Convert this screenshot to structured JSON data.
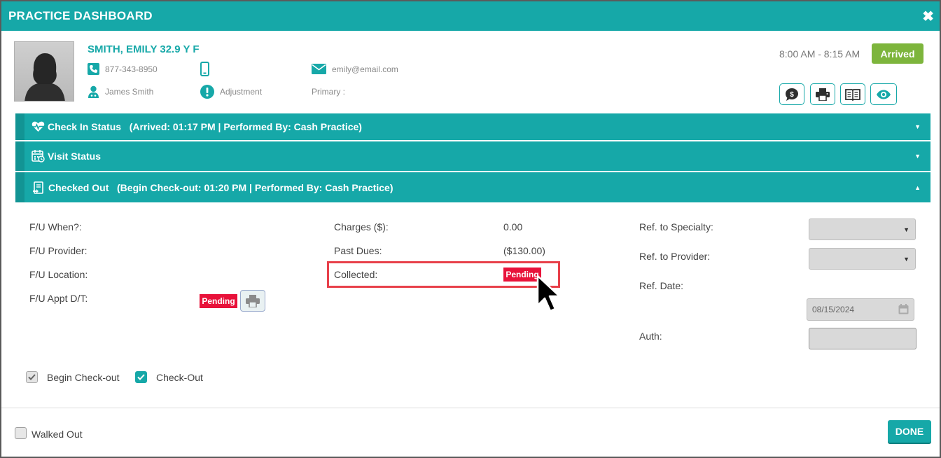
{
  "window": {
    "title": "PRACTICE DASHBOARD",
    "close_glyph": "✖"
  },
  "patient": {
    "name": "SMITH, EMILY 32.9 Y F",
    "phone": "877-343-8950",
    "email": "emily@email.com",
    "provider": "James Smith",
    "alert": "Adjustment",
    "insurance": "Primary :"
  },
  "appointment": {
    "time": "8:00 AM - 8:15 AM",
    "status": "Arrived"
  },
  "actions": [
    "dollar-chat-icon",
    "print-icon",
    "book-icon",
    "eye-icon"
  ],
  "sections": {
    "check_in": "Check In Status   (Arrived: 01:17 PM | Performed By: Cash Practice)",
    "visit": "Visit Status",
    "checked_out": "Checked Out   (Begin Check-out: 01:20 PM | Performed By: Cash Practice)"
  },
  "checkout": {
    "fu_when": "F/U When?:",
    "fu_provider": "F/U Provider:",
    "fu_location": "F/U Location:",
    "fu_appt": "F/U Appt D/T:",
    "fu_appt_status": "Pending",
    "charges_label": "Charges ($):",
    "charges_value": "0.00",
    "past_dues_label": "Past Dues:",
    "past_dues_value": "($130.00)",
    "collected_label": "Collected:",
    "collected_status": "Pending",
    "ref_specialty": "Ref. to Specialty:",
    "ref_provider": "Ref. to Provider:",
    "ref_date": "Ref. Date:",
    "ref_date_value": "08/15/2024",
    "auth": "Auth:"
  },
  "checkboxes": {
    "begin_checkout": {
      "label": "Begin Check-out",
      "checked": true
    },
    "checkout": {
      "label": "Check-Out",
      "checked": true
    },
    "walked_out": {
      "label": "Walked Out",
      "checked": false
    }
  },
  "footer": {
    "done": "DONE"
  },
  "colors": {
    "accent": "#16a8a8",
    "arrived": "#7db53c",
    "pending": "#e8123a",
    "highlight": "#e8404a"
  }
}
